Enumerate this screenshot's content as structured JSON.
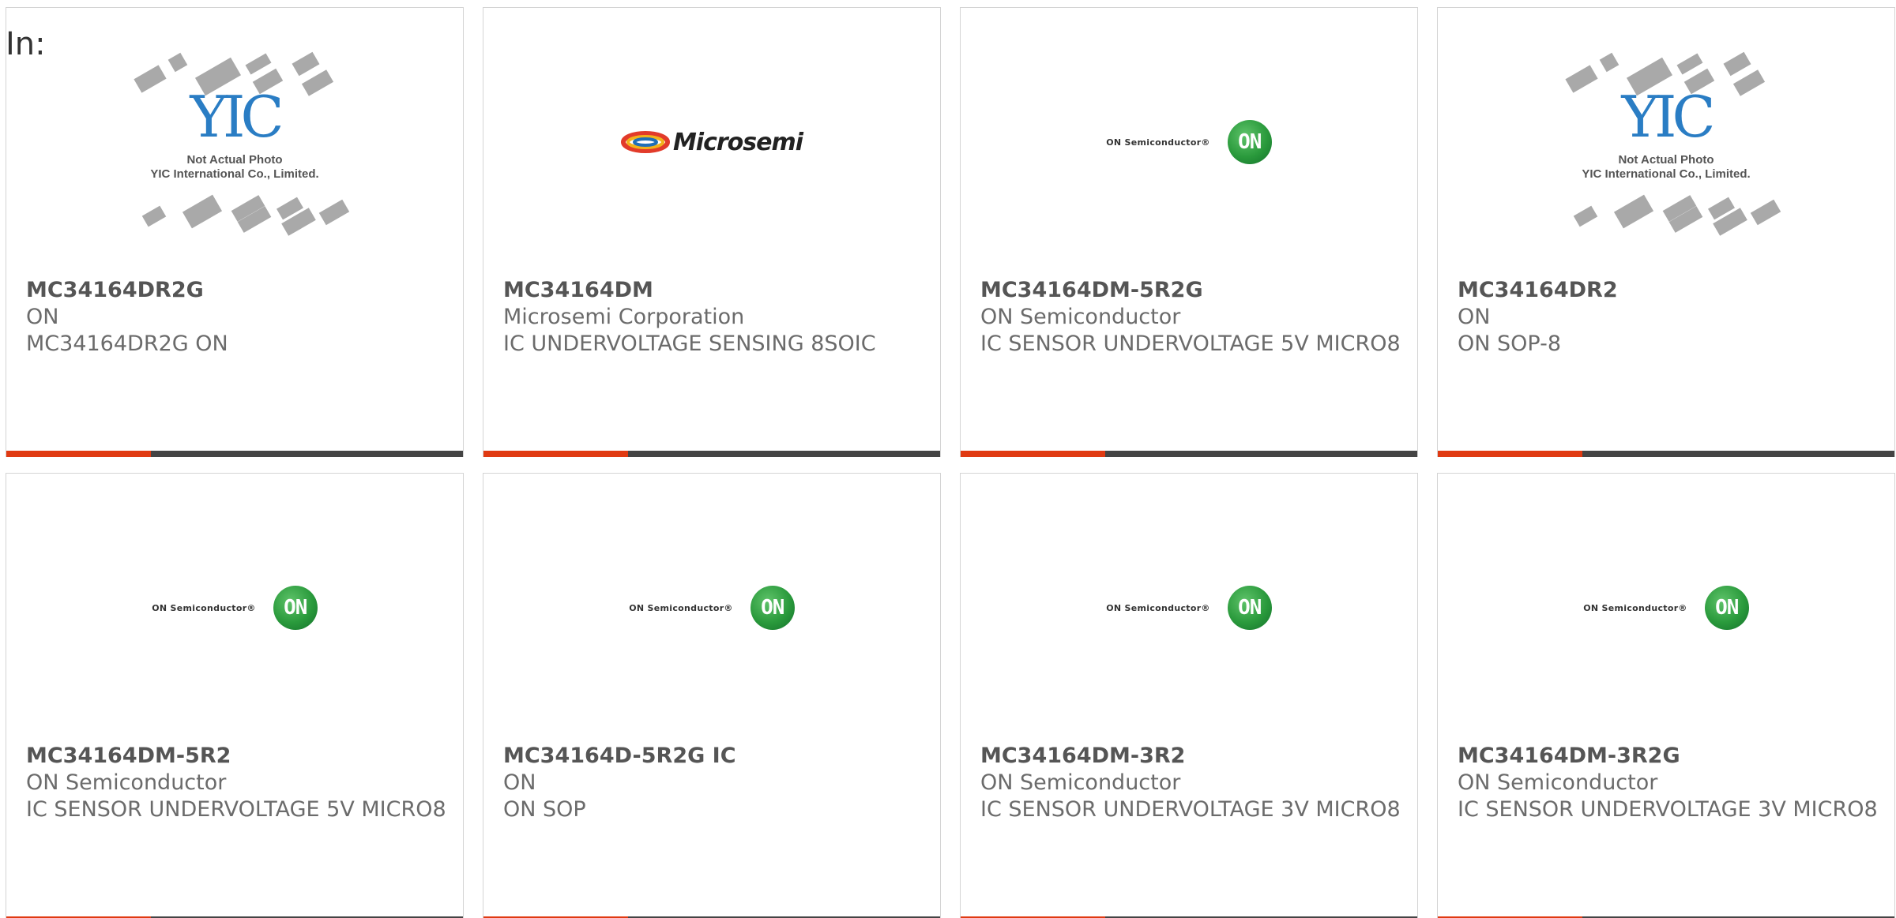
{
  "header": {
    "label": "In:"
  },
  "logos": {
    "on_semi_text": "ON Semiconductor®",
    "on_circle_text": "ON",
    "microsemi_text": "Microsemi",
    "yic_mark": "YIC",
    "yic_caption_line1": "Not Actual Photo",
    "yic_caption_line2": "YIC International Co., Limited."
  },
  "colors": {
    "accent_bar": "#e03a12",
    "dark_bar": "#444444",
    "text": "#6b6b6b"
  },
  "products": [
    {
      "part_number": "MC34164DR2G",
      "manufacturer": "ON",
      "description": "MC34164DR2G ON",
      "image": "yic-placeholder"
    },
    {
      "part_number": "MC34164DM",
      "manufacturer": "Microsemi Corporation",
      "description": "IC UNDERVOLTAGE SENSING 8SOIC",
      "image": "microsemi-logo"
    },
    {
      "part_number": "MC34164DM-5R2G",
      "manufacturer": "ON Semiconductor",
      "description": "IC SENSOR UNDERVOLTAGE 5V MICRO8",
      "image": "on-semi-logo"
    },
    {
      "part_number": "MC34164DR2",
      "manufacturer": "ON",
      "description": "ON SOP-8",
      "image": "yic-placeholder"
    },
    {
      "part_number": "MC34164DM-5R2",
      "manufacturer": "ON Semiconductor",
      "description": "IC SENSOR UNDERVOLTAGE 5V MICRO8",
      "image": "on-semi-logo"
    },
    {
      "part_number": "MC34164D-5R2G IC",
      "manufacturer": "ON",
      "description": "ON SOP",
      "image": "on-semi-logo"
    },
    {
      "part_number": "MC34164DM-3R2",
      "manufacturer": "ON Semiconductor",
      "description": "IC SENSOR UNDERVOLTAGE 3V MICRO8",
      "image": "on-semi-logo"
    },
    {
      "part_number": "MC34164DM-3R2G",
      "manufacturer": "ON Semiconductor",
      "description": "IC SENSOR UNDERVOLTAGE 3V MICRO8",
      "image": "on-semi-logo"
    }
  ]
}
